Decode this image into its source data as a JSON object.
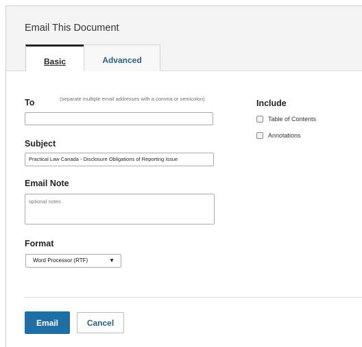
{
  "dialog": {
    "title": "Email This Document",
    "tabs": [
      {
        "label": "Basic",
        "active": true
      },
      {
        "label": "Advanced",
        "active": false
      }
    ]
  },
  "form": {
    "to": {
      "label": "To",
      "hint": "(separate multiple email addresses with a comma or semicolon)",
      "value": ""
    },
    "subject": {
      "label": "Subject",
      "value": "Practical Law Canada - Disclosure Obligations of Reporting Issue"
    },
    "note": {
      "label": "Email Note",
      "placeholder": "optional notes"
    },
    "format": {
      "label": "Format",
      "selected": "Word Processor (RTF)"
    }
  },
  "include": {
    "label": "Include",
    "options": [
      {
        "label": "Table of Contents",
        "checked": false
      },
      {
        "label": "Annotations",
        "checked": false
      }
    ]
  },
  "actions": {
    "email_label": "Email",
    "cancel_label": "Cancel"
  },
  "colors": {
    "primary": "#1f6fa5",
    "link": "#2a5f86",
    "header_bg": "#f4f4f4"
  }
}
